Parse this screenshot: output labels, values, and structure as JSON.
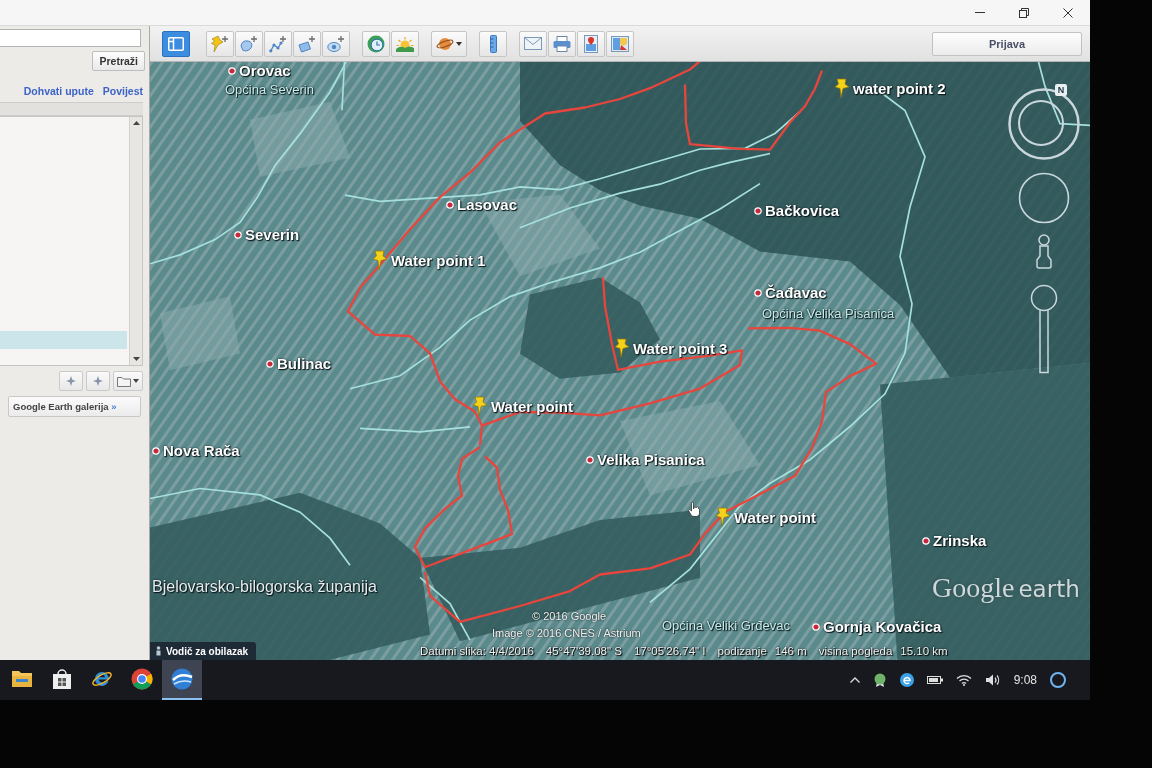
{
  "window": {
    "sign_in_button": "Prijava"
  },
  "toolbar": {
    "sidebar_button": {
      "selected": true
    }
  },
  "sidebar": {
    "search_button": "Pretraži",
    "links": [
      "Dohvati upute",
      "Povijest"
    ],
    "places_rows": [
      {
        "selected": true
      }
    ],
    "gallery_button": {
      "label": "Google Earth galerija",
      "arrow": "»"
    }
  },
  "map": {
    "labels": [
      {
        "kind": "town",
        "name": "Orovac"
      },
      {
        "kind": "region",
        "name": "Općina Severin"
      },
      {
        "kind": "town",
        "name": "Lasovac"
      },
      {
        "kind": "town",
        "name": "Severin"
      },
      {
        "kind": "placemark",
        "name": "Water point 1"
      },
      {
        "kind": "placemark",
        "name": "water point 2"
      },
      {
        "kind": "town",
        "name": "Bačkovica"
      },
      {
        "kind": "town",
        "name": "Bulinac"
      },
      {
        "kind": "placemark",
        "name": "Water point 3"
      },
      {
        "kind": "town",
        "name": "Čađavac"
      },
      {
        "kind": "region",
        "name": "Općina Velika Pisanica"
      },
      {
        "kind": "placemark",
        "name": "Water point"
      },
      {
        "kind": "town",
        "name": "Nova Rača"
      },
      {
        "kind": "town",
        "name": "Velika Pisanica"
      },
      {
        "kind": "placemark",
        "name": "Water point"
      },
      {
        "kind": "county",
        "name": "Bjelovarsko-bilogorska županija"
      },
      {
        "kind": "town",
        "name": "Zrinska"
      },
      {
        "kind": "region",
        "name": "Općina Veliki Grđevac"
      },
      {
        "kind": "town",
        "name": "Gornja Kovačica"
      }
    ],
    "attribution": [
      "© 2016 Google",
      "Image © 2016 CNES / Astrium"
    ],
    "compass": {
      "north": "N"
    },
    "logo": {
      "brand": "Google",
      "product": "earth"
    },
    "tour_guide": {
      "label": "Vodič za obilazak"
    },
    "status_bar": {
      "imagery_date": "Datumi slika: 4/4/2016",
      "latitude": "45°47'39.08\" S",
      "longitude": "17°05'26.74\" I",
      "elevation_label": "podizanje",
      "elevation": "146 m",
      "eye_altitude_label": "visina pogleda",
      "eye_altitude": "15.10 km"
    }
  },
  "taskbar": {
    "apps": [
      {
        "kind": "explorer",
        "selected": false
      },
      {
        "kind": "store",
        "selected": false
      },
      {
        "kind": "ie",
        "selected": false
      },
      {
        "kind": "chrome",
        "selected": false
      },
      {
        "kind": "earth",
        "selected": true
      }
    ],
    "clock": "9:08"
  }
}
